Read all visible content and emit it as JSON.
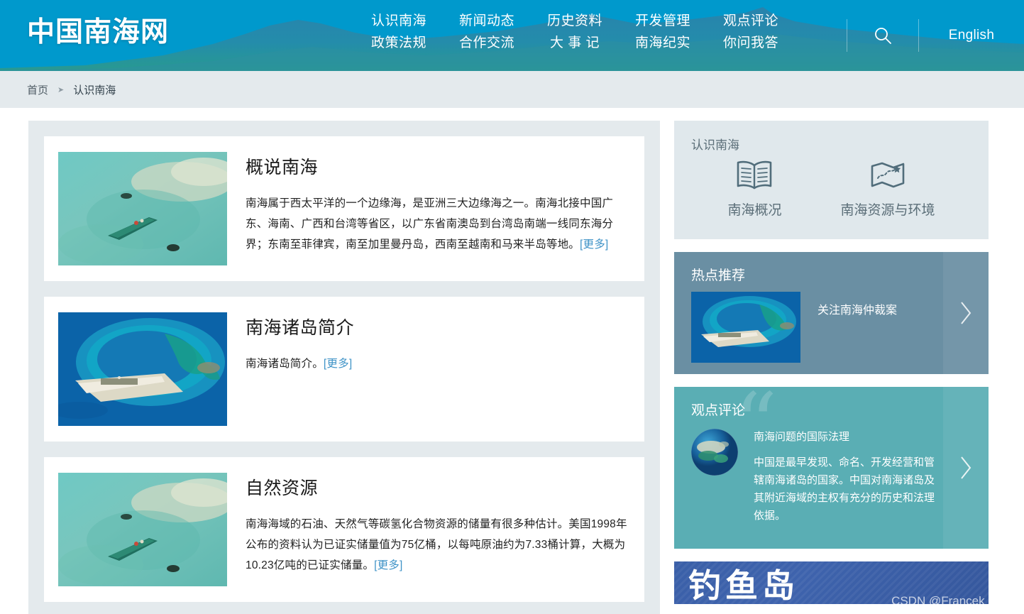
{
  "site": {
    "logo_text": "中国南海网",
    "language_toggle": "English",
    "search_icon": "search-icon"
  },
  "nav": [
    {
      "top": "认识南海",
      "bottom": "政策法规"
    },
    {
      "top": "新闻动态",
      "bottom": "合作交流"
    },
    {
      "top": "历史资料",
      "bottom": "大 事 记"
    },
    {
      "top": "开发管理",
      "bottom": "南海纪实"
    },
    {
      "top": "观点评论",
      "bottom": "你问我答"
    }
  ],
  "breadcrumb": {
    "home": "首页",
    "separator": "➤",
    "current": "认识南海"
  },
  "articles": [
    {
      "title": "概说南海",
      "text": "南海属于西太平洋的一个边缘海，是亚洲三大边缘海之一。南海北接中国广东、海南、广西和台湾等省区，以广东省南澳岛到台湾岛南端一线同东海分界；东南至菲律宾，南至加里曼丹岛，西南至越南和马来半岛等地。",
      "more": "[更多]",
      "image_name": "boat-in-shallow-water-photo"
    },
    {
      "title": "南海诸岛简介",
      "text": "南海诸岛简介。",
      "more": "[更多]",
      "image_name": "aerial-island-atoll-photo"
    },
    {
      "title": "自然资源",
      "text": "南海海域的石油、天然气等碳氢化合物资源的储量有很多种估计。美国1998年公布的资料认为已证实储量值为75亿桶，以每吨原油约为7.33桶计算，大概为10.23亿吨的已证实储量。",
      "more": "[更多]",
      "image_name": "boat-in-shallow-water-photo"
    }
  ],
  "sidebar": {
    "know_panel": {
      "title": "认识南海",
      "items": [
        {
          "label": "南海概况",
          "icon": "open-book-icon"
        },
        {
          "label": "南海资源与环境",
          "icon": "folded-map-icon"
        }
      ]
    },
    "hot_panel": {
      "title": "热点推荐",
      "item_title": "关注南海仲裁案",
      "image_name": "island-runway-photo",
      "next_icon": "chevron-right-icon"
    },
    "opinion_panel": {
      "title": "观点评论",
      "quote_glyph": "“",
      "item_title": "南海问题的国际法理",
      "item_desc": "中国是最早发现、命名、开发经营和管辖南海诸岛的国家。中国对南海诸岛及其附近海域的主权有充分的历史和法理依据。",
      "image_name": "globe-island-photo",
      "next_icon": "chevron-right-icon"
    },
    "diaoyu_banner": {
      "title": "钓鱼岛"
    }
  },
  "watermark": "CSDN @Francek Chen",
  "colors": {
    "header_blue": "#0099cc",
    "breadcrumb_bg": "#e4eaed",
    "panel_know_bg": "#e0e8ec",
    "panel_hot_bg": "#6a8fa3",
    "panel_opinion_bg": "#5aaeb4",
    "link_blue": "#3f93c7",
    "banner_blue": "#3a5fa8"
  }
}
